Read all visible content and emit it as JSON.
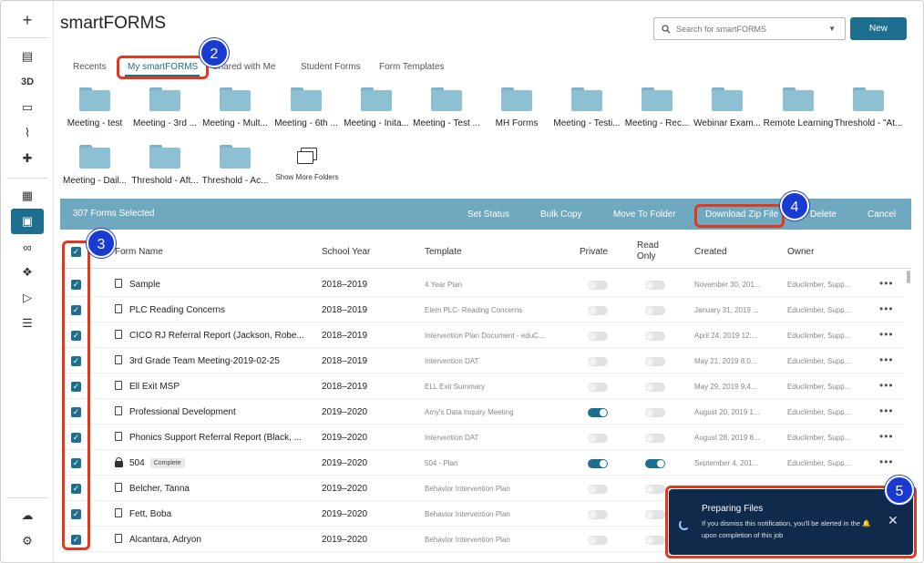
{
  "app": {
    "title": "smartFORMS"
  },
  "rail": {
    "items": [
      {
        "name": "plus-icon",
        "glyph": "+"
      },
      {
        "name": "id-card-icon",
        "glyph": "▤"
      },
      {
        "name": "3d-icon",
        "glyph": "3D"
      },
      {
        "name": "monitor-icon",
        "glyph": "▭"
      },
      {
        "name": "chart-icon",
        "glyph": "⌇"
      },
      {
        "name": "puzzle-icon",
        "glyph": "✚"
      },
      {
        "name": "calendar-icon",
        "glyph": "▦"
      },
      {
        "name": "clipboard-icon",
        "glyph": "▣"
      },
      {
        "name": "binoculars-icon",
        "glyph": "∞"
      },
      {
        "name": "network-icon",
        "glyph": "❖"
      },
      {
        "name": "flag-icon",
        "glyph": "▷"
      },
      {
        "name": "checklist-icon",
        "glyph": "☰"
      },
      {
        "name": "cloud-upload-icon",
        "glyph": "☁"
      },
      {
        "name": "gear-icon",
        "glyph": "⚙"
      }
    ]
  },
  "search": {
    "placeholder": "Search for smartFORMS"
  },
  "header": {
    "new_label": "New"
  },
  "tabs": [
    "Recents",
    "My smartFORMS",
    "Shared with Me",
    "Student Forms",
    "Form Templates"
  ],
  "folders": [
    "Meeting - test",
    "Meeting - 3rd ...",
    "Meeting - Mult...",
    "Meeting - 6th ...",
    "Meeting - Inita...",
    "Meeting - Test ...",
    "MH Forms",
    "Meeting - Testi...",
    "Meeting - Rec...",
    "Webinar Exam...",
    "Remote Learning",
    "Threshold - \"At...",
    "Meeting - Dail...",
    "Threshold - Aft...",
    "Threshold - Ac..."
  ],
  "show_more_folders": "Show More Folders",
  "selection_bar": {
    "count": "307 Forms Selected",
    "actions": [
      "Set Status",
      "Bulk Copy",
      "Move To Folder",
      "Download Zip File",
      "Delete",
      "Cancel"
    ]
  },
  "table": {
    "headers": {
      "name": "Form Name",
      "year": "School Year",
      "template": "Template",
      "private": "Private",
      "read_only_1": "Read",
      "read_only_2": "Only",
      "created": "Created",
      "owner": "Owner"
    },
    "rows": [
      {
        "name": "Sample",
        "year": "2018–2019",
        "template": "4 Year Plan",
        "private": false,
        "read_only": false,
        "created": "November 30, 201...",
        "owner": "Educlimber, Supp...",
        "icon": "doc"
      },
      {
        "name": "PLC Reading Concerns",
        "year": "2018–2019",
        "template": "Elem PLC- Reading Concerns",
        "private": false,
        "read_only": false,
        "created": "January 31, 2019 ...",
        "owner": "Educlimber, Supp...",
        "icon": "doc"
      },
      {
        "name": "CICO RJ Referral Report (Jackson, Robe...",
        "year": "2018–2019",
        "template": "Intervention Plan Document - eduC...",
        "private": false,
        "read_only": false,
        "created": "April 24, 2019 12:...",
        "owner": "Educlimber, Supp...",
        "icon": "doc"
      },
      {
        "name": "3rd Grade Team Meeting-2019-02-25",
        "year": "2018–2019",
        "template": "Intervention DAT",
        "private": false,
        "read_only": false,
        "created": "May 21, 2019 8:0...",
        "owner": "Educlimber, Supp...",
        "icon": "doc"
      },
      {
        "name": "Ell Exit MSP",
        "year": "2018–2019",
        "template": "ELL Exit Summary",
        "private": false,
        "read_only": false,
        "created": "May 29, 2019 9:4...",
        "owner": "Educlimber, Supp...",
        "icon": "doc"
      },
      {
        "name": "Professional Development",
        "year": "2019–2020",
        "template": "Amy's Data Inquiry Meeting",
        "private": true,
        "read_only": false,
        "created": "August 20, 2019 1...",
        "owner": "Educlimber, Supp...",
        "icon": "doc"
      },
      {
        "name": "Phonics Support Referral Report (Black, ...",
        "year": "2019–2020",
        "template": "Intervention DAT",
        "private": false,
        "read_only": false,
        "created": "August 28, 2019 8...",
        "owner": "Educlimber, Supp...",
        "icon": "doc"
      },
      {
        "name": "504",
        "badge": "Complete",
        "year": "2019–2020",
        "template": "504 - Plan",
        "private": true,
        "read_only": true,
        "created": "September 4, 201...",
        "owner": "Educlimber, Supp...",
        "icon": "lock"
      },
      {
        "name": "Belcher, Tanna",
        "year": "2019–2020",
        "template": "Behavior Intervention Plan",
        "private": false,
        "read_only": false,
        "created": "",
        "owner": "",
        "icon": "doc"
      },
      {
        "name": "Fett, Boba",
        "year": "2019–2020",
        "template": "Behavior Intervention Plan",
        "private": false,
        "read_only": false,
        "created": "",
        "owner": "",
        "icon": "doc"
      },
      {
        "name": "Alcantara, Adryon",
        "year": "2019–2020",
        "template": "Behavior Intervention Plan",
        "private": false,
        "read_only": false,
        "created": "",
        "owner": "",
        "icon": "doc"
      }
    ]
  },
  "toast": {
    "title": "Preparing Files",
    "message": "If you dismiss this notification, you'll be alerted in the 🔔 upon completion of this job"
  },
  "annotations": [
    "2",
    "3",
    "4",
    "5"
  ],
  "colors": {
    "accent": "#1e6f8f",
    "selection_bar": "#6fa9bf",
    "annotation_box": "#e03a1e",
    "annotation_badge": "#1a3bd1",
    "toast_bg": "#0f2a4a"
  }
}
